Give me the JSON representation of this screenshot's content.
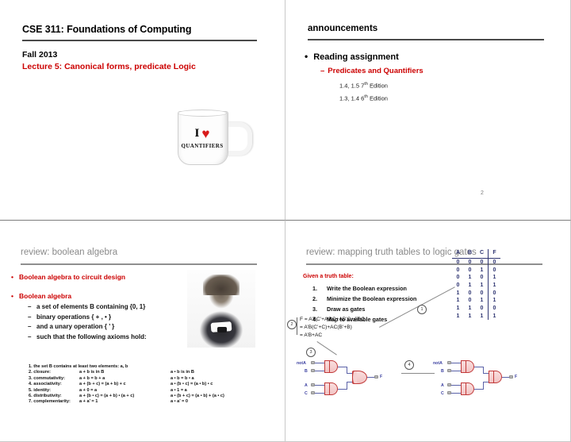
{
  "meta": {
    "accent_red": "#cc0000",
    "header_gray": "#8a8a8a",
    "table_blue": "#2f3572"
  },
  "slide_title": {
    "course": "CSE 311: Foundations of Computing",
    "term": "Fall 2013",
    "lecture": "Lecture 5: Canonical forms, predicate Logic",
    "mug_i": "I",
    "mug_heart": "♥",
    "mug_word": "QUANTIFIERS"
  },
  "slide_announcements": {
    "title": "announcements",
    "bullet_dot": "•",
    "bullet": "Reading assignment",
    "dash": "–",
    "subbullet": "Predicates and Quantifiers",
    "reading_lines": [
      {
        "sections": "1.4, 1.5",
        "edition_num": "7",
        "sup": "th",
        "edition_word": "Edition"
      },
      {
        "sections": "1.3, 1.4",
        "edition_num": "6",
        "sup": "th",
        "edition_word": "Edition"
      }
    ],
    "page_number": "2"
  },
  "slide_boolean": {
    "title": "review: boolean algebra",
    "bullet_dot": "•",
    "bullet1": "Boolean algebra to circuit design",
    "bullet2": "Boolean algebra",
    "dash": "–",
    "sub_items": [
      "a set of elements B containing {0, 1}",
      "binary operations { + , • }",
      "and a unary operation { ’ }",
      "such that the following axioms hold:"
    ],
    "portrait_alt": "George Boole portrait",
    "axioms": [
      {
        "n": "1.",
        "name": "the set B contains at least two elements: a, b",
        "left": "",
        "right": ""
      },
      {
        "n": "2.",
        "name": "closure:",
        "left": "a + b   is in B",
        "right": "a • b   is in B"
      },
      {
        "n": "3.",
        "name": "commutativity:",
        "left": "a + b = b + a",
        "right": "a • b = b • a"
      },
      {
        "n": "4.",
        "name": "associativity:",
        "left": "a + (b + c) = (a + b) + c",
        "right": "a • (b • c) = (a • b) • c"
      },
      {
        "n": "5.",
        "name": "identity:",
        "left": "a + 0 = a",
        "right": "a • 1 = a"
      },
      {
        "n": "6.",
        "name": "distributivity:",
        "left": "a + (b • c) = (a + b) • (a + c)",
        "right": "a • (b + c) = (a • b) + (a • c)"
      },
      {
        "n": "7.",
        "name": "complementarity:",
        "left": "a + a’ = 1",
        "right": "a • a’ = 0"
      }
    ]
  },
  "slide_mapping": {
    "title": "review: mapping truth tables to logic gates",
    "given": "Given a truth table:",
    "steps": [
      {
        "num": "1.",
        "text": "Write the Boolean expression"
      },
      {
        "num": "2.",
        "text": "Minimize the Boolean expression"
      },
      {
        "num": "3.",
        "text": "Draw as gates"
      },
      {
        "num": "4.",
        "text": "Map to available gates"
      }
    ],
    "truth_table": {
      "headers": [
        "A",
        "B",
        "C",
        "F"
      ],
      "rows": [
        [
          "0",
          "0",
          "0",
          "0"
        ],
        [
          "0",
          "0",
          "1",
          "0"
        ],
        [
          "0",
          "1",
          "0",
          "1"
        ],
        [
          "0",
          "1",
          "1",
          "1"
        ],
        [
          "1",
          "0",
          "0",
          "0"
        ],
        [
          "1",
          "0",
          "1",
          "1"
        ],
        [
          "1",
          "1",
          "0",
          "0"
        ],
        [
          "1",
          "1",
          "1",
          "1"
        ]
      ]
    },
    "expression_lines": [
      "F = A’BC’+A’BC+AB’C+ABC",
      "  = A’B(C’+C)+AC(B’+B)",
      "  = A’B+AC"
    ],
    "callouts": [
      "1",
      "2",
      "3",
      "4"
    ],
    "circuit_left": {
      "inputs": [
        "notA",
        "B",
        "A",
        "C"
      ],
      "output": "F"
    },
    "circuit_right": {
      "inputs": [
        "notA",
        "B",
        "A",
        "C"
      ],
      "output": "F"
    }
  }
}
